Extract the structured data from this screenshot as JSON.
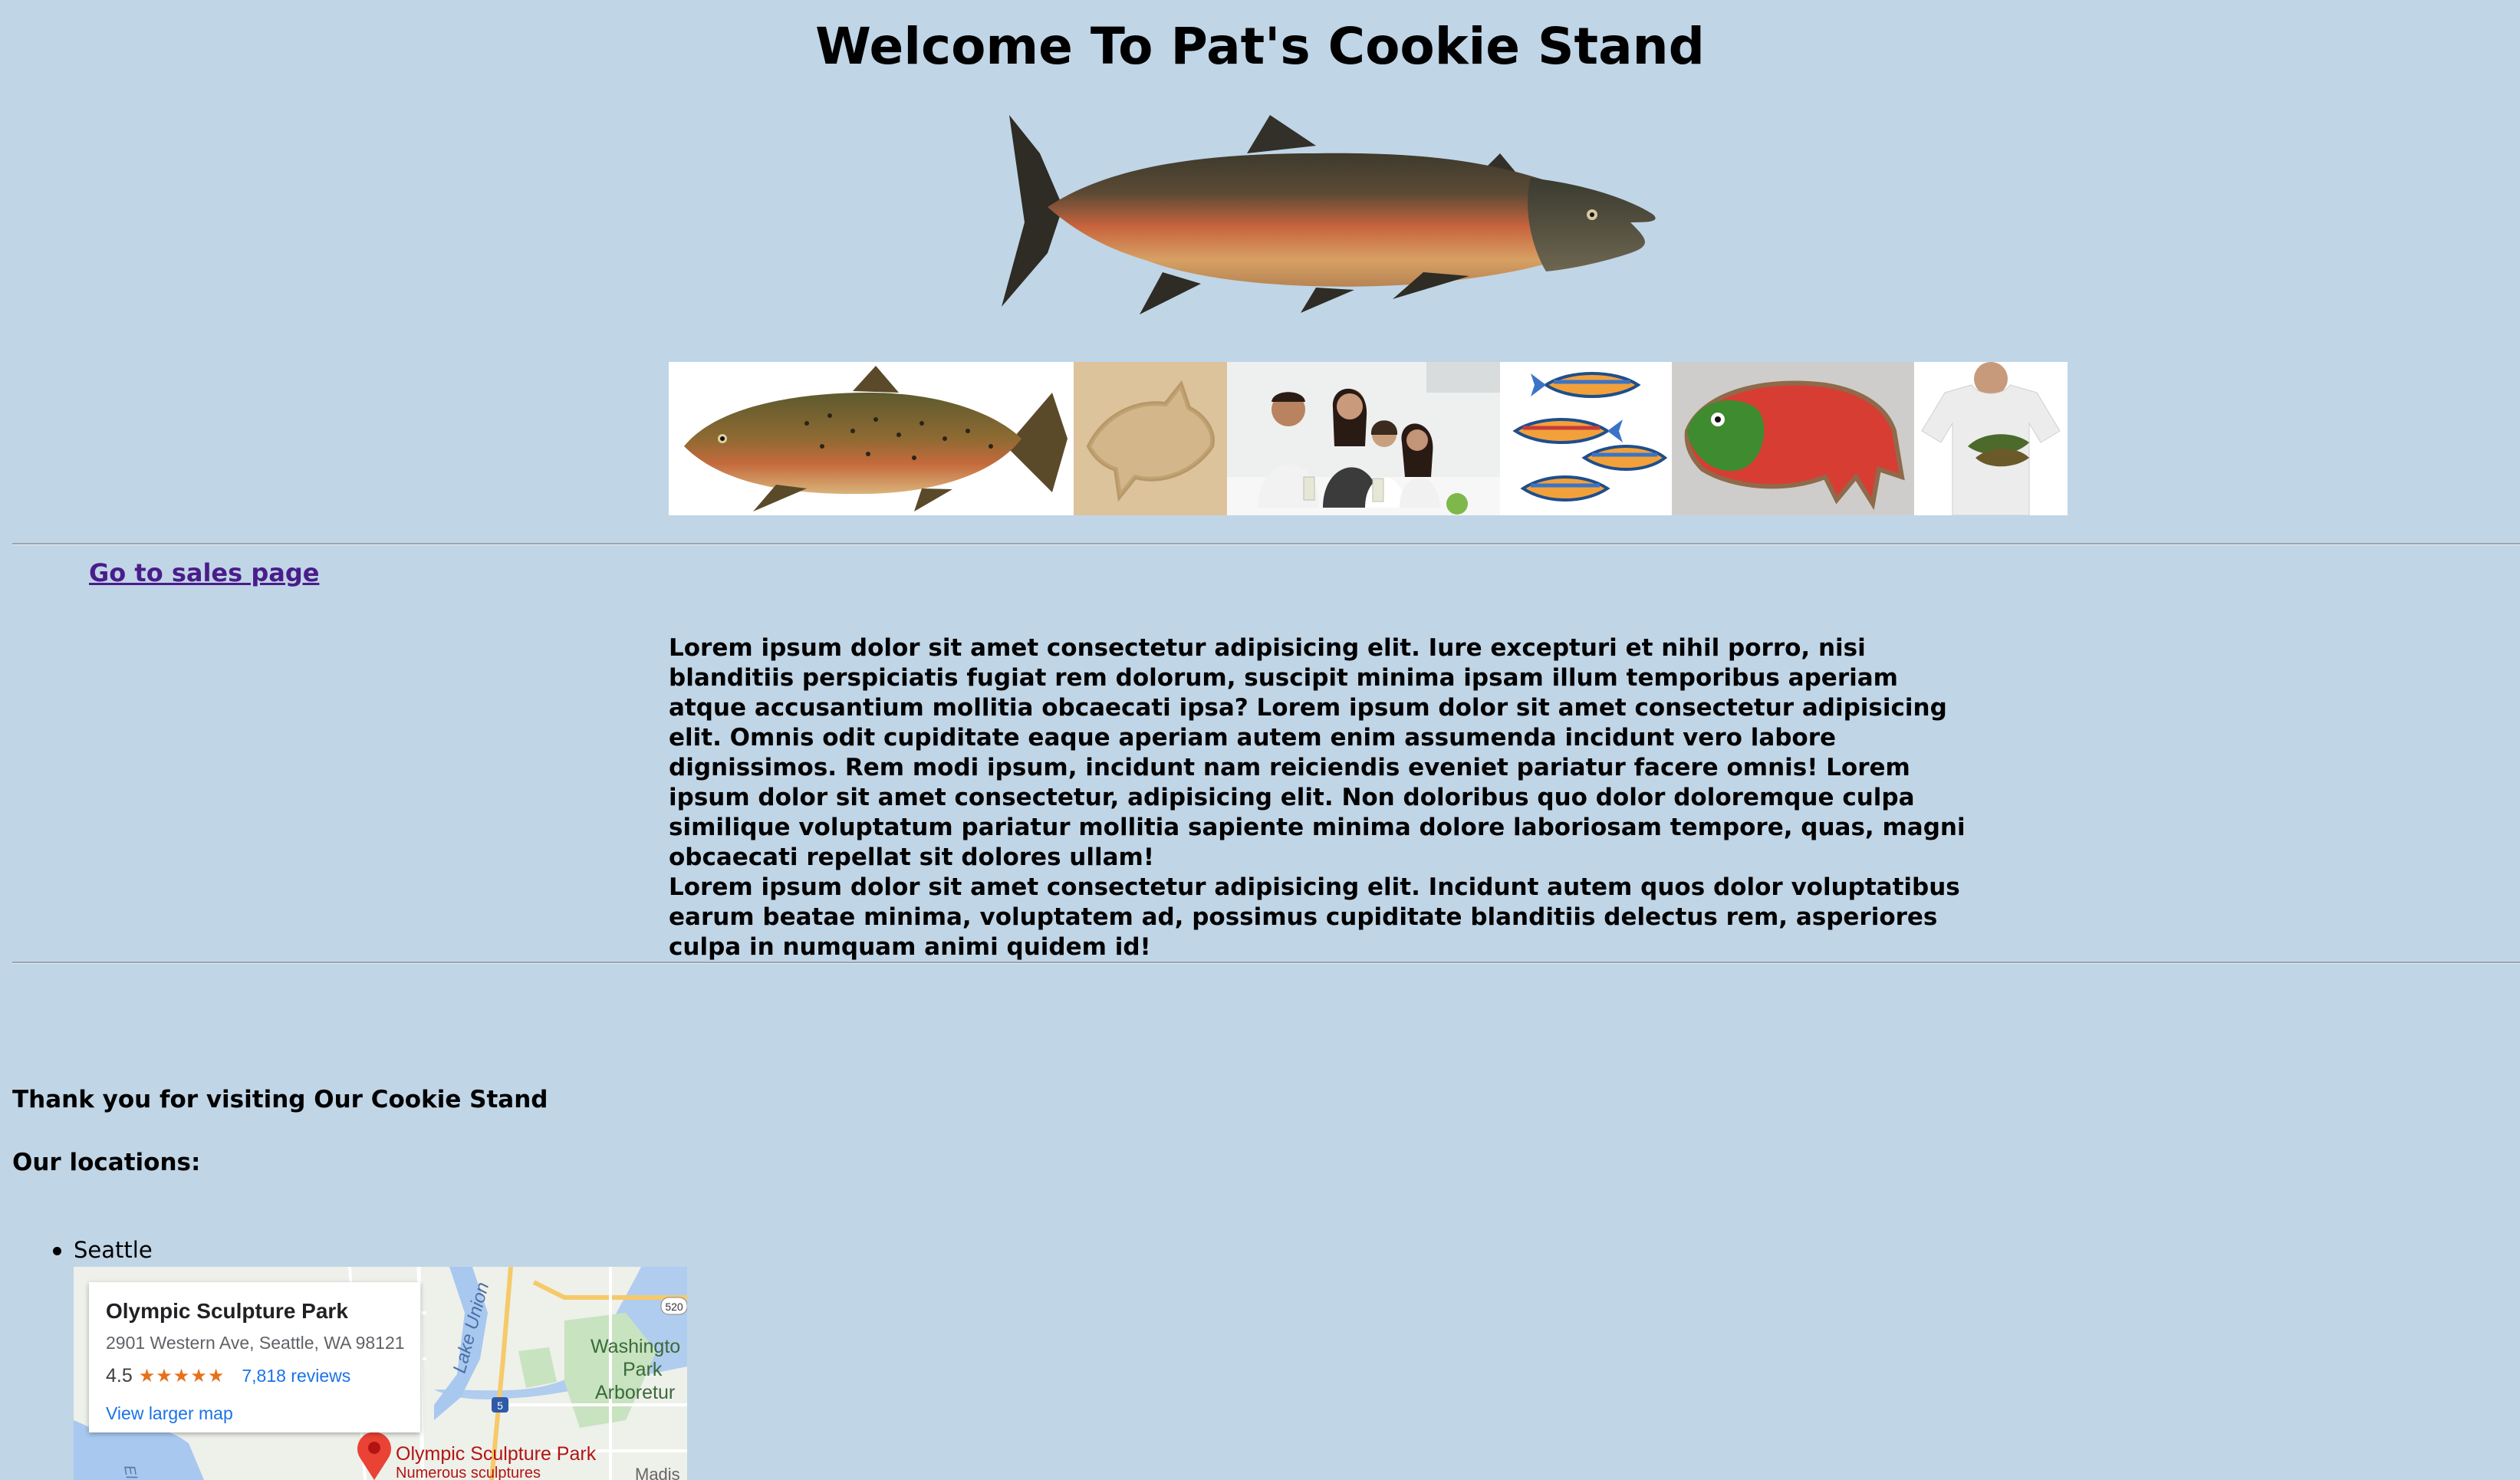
{
  "page": {
    "title": "Welcome To Pat's Cookie Stand"
  },
  "nav": {
    "sales_link": "Go to sales page"
  },
  "content": {
    "paragraph_1": "Lorem ipsum dolor sit amet consectetur adipisicing elit. Iure excepturi et nihil porro, nisi blanditiis perspiciatis fugiat rem dolorum, suscipit minima ipsam illum temporibus aperiam atque accusantium mollitia obcaecati ipsa? Lorem ipsum dolor sit amet consectetur adipisicing elit. Omnis odit cupiditate eaque aperiam autem enim assumenda incidunt vero labore dignissimos. Rem modi ipsum, incidunt nam reiciendis eveniet pariatur facere omnis! Lorem ipsum dolor sit amet consectetur, adipisicing elit. Non doloribus quo dolor doloremque culpa similique voluptatum pariatur mollitia sapiente minima dolore laboriosam tempore, quas, magni obcaecati repellat sit dolores ullam!",
    "paragraph_2": "Lorem ipsum dolor sit amet consectetur adipisicing elit. Incidunt autem quos dolor voluptatibus earum beatae minima, voluptatem ad, possimus cupiditate blanditiis delectus rem, asperiores culpa in numquam animi quidem id!"
  },
  "footer": {
    "thanks": "Thank you for visiting Our Cookie Stand",
    "locations_heading": "Our locations:",
    "locations": [
      {
        "name": "Seattle",
        "map": {
          "place_name": "Olympic Sculpture Park",
          "address": "2901 Western Ave, Seattle, WA 98121",
          "rating": "4.5",
          "stars": "★★★★★",
          "reviews": "7,818 reviews",
          "larger_map": "View larger map",
          "labels": {
            "lake_union": "Lake Union",
            "arboretum_1": "Washingto",
            "arboretum_2": "Park",
            "arboretum_3": "Arboretur",
            "pin_title": "Olympic Sculpture Park",
            "pin_subtitle": "Numerous sculptures",
            "elliott": "Elliot",
            "madison": "Madis",
            "highway_5": "5",
            "highway_520": "520"
          }
        }
      }
    ]
  }
}
